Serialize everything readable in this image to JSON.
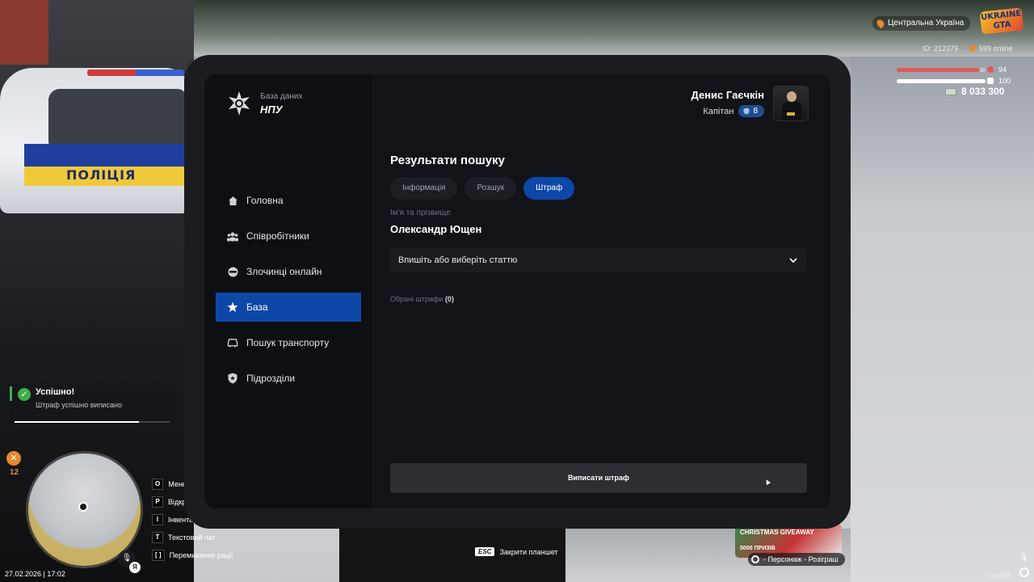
{
  "hud": {
    "region": "Центральна Україна",
    "logo_text": "УКРАЇНА GTA",
    "player_id": "ID: 212379",
    "online": "599 online",
    "health": 94,
    "health_label": "94",
    "armor": 100,
    "armor_label": "100",
    "money": "8 033 300",
    "health_color": "#e05a5a",
    "armor_color": "#ffffff"
  },
  "notification": {
    "title": "Успішно!",
    "message": "Штраф успішно виписано",
    "progress": 0.8
  },
  "left_hud": {
    "tool_count": "12",
    "lang": "Я",
    "datetime": "27.02.2026 | 17:02"
  },
  "key_hints": [
    {
      "key": "O",
      "label": "Меню"
    },
    {
      "key": "P",
      "label": "Відкрити"
    },
    {
      "key": "I",
      "label": "Інвентар"
    },
    {
      "key": "T",
      "label": "Текстовий чат"
    },
    {
      "key": "[ ]",
      "label": "Перемикання рації"
    }
  ],
  "esc_hint": {
    "key": "ESC",
    "label": "Закрити планшет"
  },
  "giveaway": {
    "title": "CHRISTMAS GIVEAWAY",
    "subtitle": "5000 ПРИЗІВ",
    "hint": "- Персонаж - Розіграш"
  },
  "watermark": "UA GTA",
  "tablet": {
    "brand": {
      "subtitle": "База даних",
      "title": "НПУ"
    },
    "user": {
      "name": "Денис Гаєчкін",
      "rank": "Капітан",
      "rank_level": "8"
    },
    "nav": [
      {
        "label": "Головна",
        "icon": "home-icon",
        "active": false
      },
      {
        "label": "Співробітники",
        "icon": "users-icon",
        "active": false
      },
      {
        "label": "Злочинці онлайн",
        "icon": "criminal-icon",
        "active": false
      },
      {
        "label": "База",
        "icon": "star-icon",
        "active": true
      },
      {
        "label": "Пошук транспорту",
        "icon": "car-icon",
        "active": false
      },
      {
        "label": "Підрозділи",
        "icon": "shield-icon",
        "active": false
      }
    ],
    "content": {
      "title": "Результати пошуку",
      "tabs": [
        {
          "label": "Інформація",
          "active": false
        },
        {
          "label": "Розшук",
          "active": false
        },
        {
          "label": "Штраф",
          "active": true
        }
      ],
      "name_label": "Ім'я та прізвище",
      "name_value": "Олександр Ющен",
      "select_placeholder": "Впишіть або виберіть статтю",
      "chosen_label": "Обрані штрафи",
      "chosen_count": "(0)",
      "submit_label": "Виписати штраф"
    }
  }
}
